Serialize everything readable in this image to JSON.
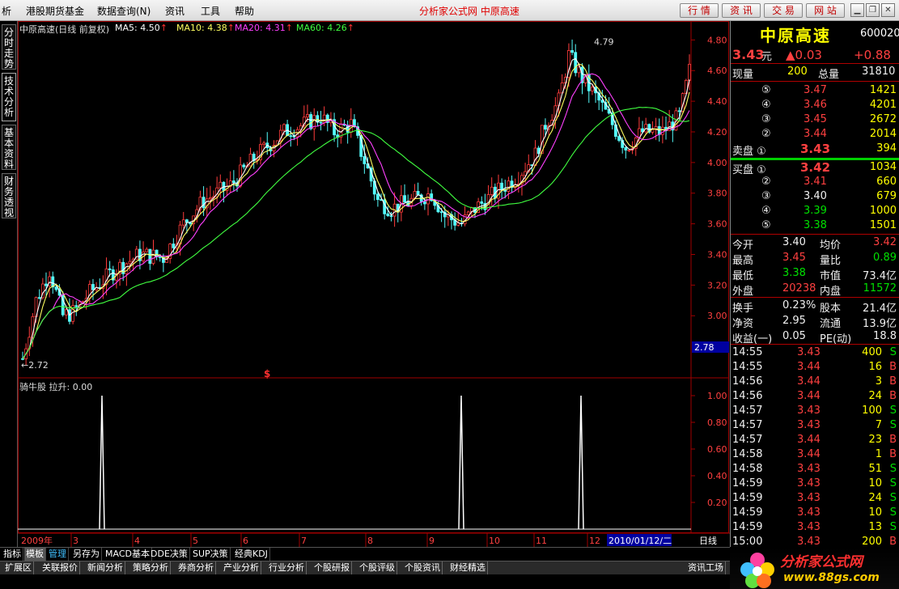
{
  "menubar": {
    "items": [
      "析",
      "港股期货基金",
      "数据查询(N)",
      "资讯",
      "工具",
      "帮助"
    ],
    "title": "分析家公式网  中原高速",
    "buttons": [
      "行 情",
      "资 讯",
      "交 易",
      "网 站"
    ]
  },
  "lefttabs": [
    "分时走势",
    "技术分析",
    "基本资料",
    "财务透视"
  ],
  "chart": {
    "name": "中原高速(日线 前复权)",
    "ma": [
      {
        "label": "MA5: 4.50",
        "color": "#ffffff"
      },
      {
        "label": "MA10: 4.38",
        "color": "#ffff60"
      },
      {
        "label": "MA20: 4.31",
        "color": "#ff40ff"
      },
      {
        "label": "MA60: 4.26",
        "color": "#40ff40"
      }
    ],
    "y_ticks": [
      "4.80",
      "4.60",
      "4.40",
      "4.20",
      "4.00",
      "3.80",
      "3.60",
      "3.40",
      "3.20",
      "3.00"
    ],
    "current_price_tag": "2.78",
    "high_label": "4.79",
    "low_label": "←2.72",
    "dollar_mark": "$"
  },
  "sub": {
    "title": "骑牛股 拉升: 0.00",
    "y_ticks": [
      "1.00",
      "0.80",
      "0.60",
      "0.40",
      "0.20"
    ]
  },
  "xaxis": {
    "labels": [
      "2009年",
      "3",
      "4",
      "5",
      "6",
      "7",
      "8",
      "9",
      "10",
      "11",
      "12"
    ],
    "date_highlight": "2010/01/12/二",
    "period": "日线"
  },
  "tabs1": [
    "指标",
    "模板",
    "管理",
    "另存为",
    "MACD基本",
    "DDE决策",
    "SUP决策",
    "经典KDJ"
  ],
  "tabs2": [
    "扩展区",
    "关联报价",
    "新闻分析",
    "策略分析",
    "券商分析",
    "产业分析",
    "行业分析",
    "个股研报",
    "个股评级",
    "个股资讯",
    "财经精选"
  ],
  "tabs2_right": "资讯工场",
  "quote": {
    "name": "中原高速",
    "code": "600020",
    "price": "3.43",
    "unit": "元",
    "change": "▲0.03",
    "pct": "+0.88",
    "now_label": "现量",
    "now_val": "200",
    "total_label": "总量",
    "total_val": "31810",
    "sell": [
      {
        "lvl": "⑤",
        "price": "3.47",
        "vol": "1421"
      },
      {
        "lvl": "④",
        "price": "3.46",
        "vol": "4201"
      },
      {
        "lvl": "③",
        "price": "3.45",
        "vol": "2672"
      },
      {
        "lvl": "②",
        "price": "3.44",
        "vol": "2014"
      },
      {
        "lvl": "卖盘 ①",
        "price": "3.43",
        "vol": "394"
      }
    ],
    "buy": [
      {
        "lvl": "买盘 ①",
        "price": "3.42",
        "vol": "1034"
      },
      {
        "lvl": "②",
        "price": "3.41",
        "vol": "660"
      },
      {
        "lvl": "③",
        "price": "3.40",
        "vol": "679"
      },
      {
        "lvl": "④",
        "price": "3.39",
        "vol": "1000"
      },
      {
        "lvl": "⑤",
        "price": "3.38",
        "vol": "1501"
      }
    ],
    "stats": [
      {
        "l1": "今开",
        "v1": "3.40",
        "c1": "white",
        "l2": "均价",
        "v2": "3.42",
        "c2": "red"
      },
      {
        "l1": "最高",
        "v1": "3.45",
        "c1": "red",
        "l2": "量比",
        "v2": "0.89",
        "c2": "green"
      },
      {
        "l1": "最低",
        "v1": "3.38",
        "c1": "green",
        "l2": "市值",
        "v2": "73.4亿",
        "c2": "white"
      },
      {
        "l1": "外盘",
        "v1": "20238",
        "c1": "red",
        "l2": "内盘",
        "v2": "11572",
        "c2": "green"
      }
    ],
    "stats2": [
      {
        "l1": "换手",
        "v1": "0.23%",
        "l2": "股本",
        "v2": "21.4亿"
      },
      {
        "l1": "净资",
        "v1": "2.95",
        "l2": "流通",
        "v2": "13.9亿"
      },
      {
        "l1": "收益(一)",
        "v1": "0.05",
        "l2": "PE(动)",
        "v2": "18.8"
      }
    ],
    "ticks": [
      {
        "t": "14:55",
        "p": "3.43",
        "v": "400",
        "s": "S"
      },
      {
        "t": "14:55",
        "p": "3.44",
        "v": "16",
        "s": "B"
      },
      {
        "t": "14:56",
        "p": "3.44",
        "v": "3",
        "s": "B"
      },
      {
        "t": "14:56",
        "p": "3.44",
        "v": "24",
        "s": "B"
      },
      {
        "t": "14:57",
        "p": "3.43",
        "v": "100",
        "s": "S"
      },
      {
        "t": "14:57",
        "p": "3.43",
        "v": "7",
        "s": "S"
      },
      {
        "t": "14:57",
        "p": "3.44",
        "v": "23",
        "s": "B"
      },
      {
        "t": "14:58",
        "p": "3.44",
        "v": "1",
        "s": "B"
      },
      {
        "t": "14:58",
        "p": "3.43",
        "v": "51",
        "s": "S"
      },
      {
        "t": "14:59",
        "p": "3.43",
        "v": "10",
        "s": "S"
      },
      {
        "t": "14:59",
        "p": "3.43",
        "v": "24",
        "s": "S"
      },
      {
        "t": "14:59",
        "p": "3.43",
        "v": "10",
        "s": "S"
      },
      {
        "t": "14:59",
        "p": "3.43",
        "v": "13",
        "s": "S"
      },
      {
        "t": "15:00",
        "p": "3.43",
        "v": "200",
        "s": "B"
      }
    ]
  },
  "logo": {
    "text": "分析家公式网",
    "url": "www.88gs.com"
  }
}
